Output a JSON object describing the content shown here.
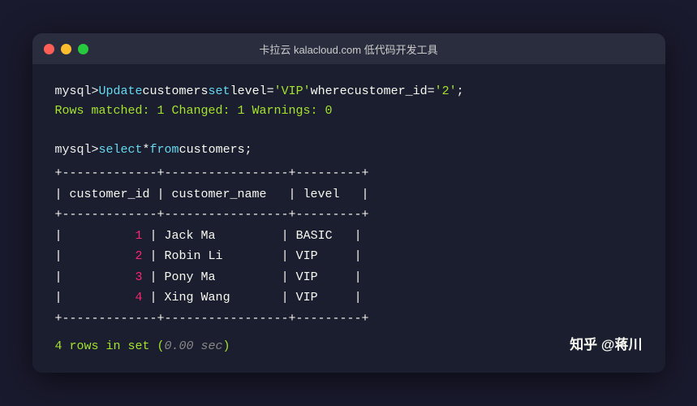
{
  "titlebar": {
    "title": "卡拉云 kalacloud.com 低代码开发工具",
    "dots": [
      "red",
      "yellow",
      "green"
    ]
  },
  "terminal": {
    "update_command": {
      "prefix": "mysql>",
      "keyword_update": "Update",
      "table": " customers ",
      "keyword_set": "set",
      "field": " level=",
      "value_vip": "'VIP'",
      "keyword_where": " where ",
      "condition_field": "customer_id=",
      "condition_value": "'2'"
    },
    "status_line": "Rows matched: 1  Changed: 1  Warnings: 0",
    "select_command": {
      "prefix": "mysql>",
      "keyword_select": "select",
      "rest": " * ",
      "keyword_from": "from",
      "table": " customers;"
    },
    "table": {
      "border": "+-------------+-----------------+---------+",
      "header": "| customer_id | customer_name   | level   |",
      "rows": [
        {
          "id": "1",
          "name": "Jack Ma",
          "level": "BASIC"
        },
        {
          "id": "2",
          "name": "Robin Li",
          "level": "VIP"
        },
        {
          "id": "3",
          "name": "Pony Ma",
          "level": "VIP"
        },
        {
          "id": "4",
          "name": "Xing Wang",
          "level": "VIP"
        }
      ]
    },
    "result": {
      "count": "4",
      "rows_label": " rows in set (",
      "sec": "0.00",
      "sec_label": " sec)"
    }
  },
  "watermark": {
    "text": "知乎 @蒋川"
  }
}
